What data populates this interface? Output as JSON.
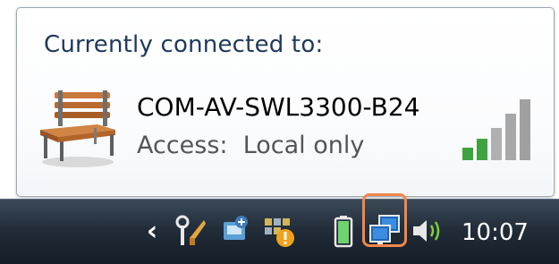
{
  "popup": {
    "title": "Currently connected to:",
    "network_name": "COM-AV-SWL3300-B24",
    "access_label": "Access:",
    "access_value": "Local only",
    "network_icon": "bench-icon",
    "signal_icon": "signal-strength-icon",
    "signal_bars_active": 2,
    "signal_bars_total": 5
  },
  "taskbar": {
    "show_hidden_icon": "chevron-left-icon",
    "tray_icons": [
      "tools-icon",
      "network-share-icon",
      "security-warning-icon",
      "battery-icon",
      "network-icon",
      "speaker-icon"
    ],
    "clock": "10:07"
  },
  "colors": {
    "popup_title": "#1e395b",
    "highlight_border": "#f0874a",
    "signal_active": "#3fa33f",
    "signal_inactive": "#a8a8a8"
  }
}
